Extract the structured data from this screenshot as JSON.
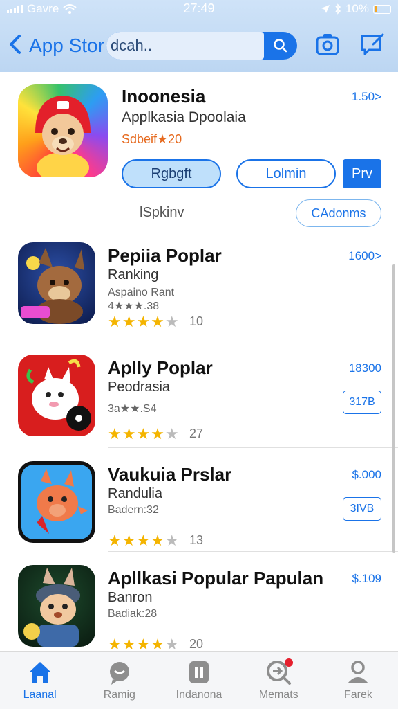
{
  "status_bar": {
    "carrier": "Gavre",
    "time": "27:49",
    "battery": "10%"
  },
  "nav": {
    "title": "App Stor",
    "search_placeholder": "dcah.."
  },
  "featured": {
    "title": "Inoonesia",
    "subtitle": "Applkasia Dpoolaia",
    "rating": "Sdbeif★20",
    "price": "1.50>",
    "primary_button": "Rgbgft",
    "outline_button": "Lolmin",
    "solid_button": "Prv",
    "section_label": "lSpkinv",
    "chip_button": "CAdonms"
  },
  "apps": [
    {
      "title": "Pepiia Poplar",
      "subtitle": "Ranking",
      "meta": "Aspaino Rant",
      "meta2": "4★★★.38",
      "stars": 4,
      "count": "10",
      "price": "1600>",
      "size": ""
    },
    {
      "title": "Aplly Poplar",
      "subtitle": "Peodrasia",
      "meta": "3a★★.S4",
      "meta2": "",
      "stars": 4,
      "count": "27",
      "price": "18300",
      "size": "317B"
    },
    {
      "title": "Vaukuia Prslar",
      "subtitle": "Randulia",
      "meta": "Badern:32",
      "meta2": "",
      "stars": 4,
      "count": "13",
      "price": "$.000",
      "size": "3IVB"
    },
    {
      "title": "Apllkasi Popular Papulan",
      "subtitle": "Banron",
      "meta": "Badiak:28",
      "meta2": "",
      "stars": 4,
      "count": "20",
      "price": "$.109",
      "size": ""
    }
  ],
  "tabs": [
    {
      "label": "Laanal",
      "icon": "home-icon"
    },
    {
      "label": "Ramig",
      "icon": "chat-icon"
    },
    {
      "label": "Indanona",
      "icon": "apps-icon"
    },
    {
      "label": "Memats",
      "icon": "search-updates-icon"
    },
    {
      "label": "Farek",
      "icon": "person-icon"
    }
  ],
  "colors": {
    "accent": "#1a73e8",
    "star": "#f4b400",
    "rating_orange": "#e66a1f",
    "badge_red": "#e5202e"
  }
}
